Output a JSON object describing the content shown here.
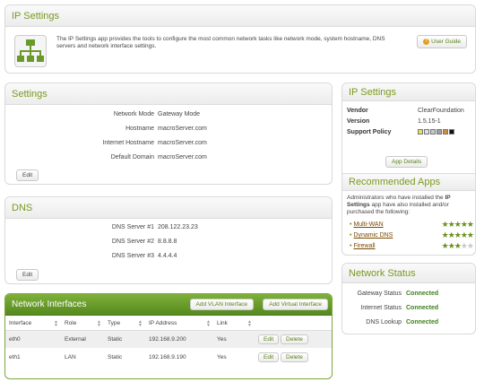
{
  "app": {
    "title": "IP Settings",
    "description": "The IP Settings app provides the tools to configure the most common network tasks like network mode, system hostname, DNS servers and network interface settings.",
    "user_guide_label": "User Guide"
  },
  "settings": {
    "title": "Settings",
    "rows": [
      {
        "label": "Network Mode",
        "value": "Gateway Mode"
      },
      {
        "label": "Hostname",
        "value": "macroServer.com"
      },
      {
        "label": "Internet Hostname",
        "value": "macroServer.com"
      },
      {
        "label": "Default Domain",
        "value": "macroServer.com"
      }
    ],
    "edit_label": "Edit"
  },
  "dns": {
    "title": "DNS",
    "rows": [
      {
        "label": "DNS Server #1",
        "value": "208.122.23.23"
      },
      {
        "label": "DNS Server #2",
        "value": "8.8.8.8"
      },
      {
        "label": "DNS Server #3",
        "value": "4.4.4.4"
      }
    ],
    "edit_label": "Edit"
  },
  "interfaces": {
    "title": "Network Interfaces",
    "add_vlan_label": "Add VLAN Interface",
    "add_virtual_label": "Add Virtual Interface",
    "columns": [
      "Interface",
      "Role",
      "Type",
      "IP Address",
      "Link"
    ],
    "rows": [
      {
        "interface": "eth0",
        "role": "External",
        "type": "Static",
        "ip": "192.168.9.200",
        "link": "Yes",
        "edit": "Edit",
        "delete": "Delete"
      },
      {
        "interface": "eth1",
        "role": "LAN",
        "type": "Static",
        "ip": "192.168.9.190",
        "link": "Yes",
        "edit": "Edit",
        "delete": "Delete"
      }
    ]
  },
  "sidebar": {
    "info_title": "IP Settings",
    "vendor_label": "Vendor",
    "vendor": "ClearFoundation",
    "version_label": "Version",
    "version": "1.5.15-1",
    "support_label": "Support Policy",
    "support_colors": [
      "#e8e05a",
      "#e0e0e0",
      "#c8c8c8",
      "#a0a0a0",
      "#c89040",
      "#111111"
    ],
    "app_details_label": "App Details",
    "recommended_title": "Recommended Apps",
    "recommended_text_pre": "Administrators who have installed the ",
    "recommended_text_app": "IP Settings",
    "recommended_text_post": " app have also installed and/or purchased the following:",
    "recommended": [
      {
        "name": "Multi-WAN",
        "rating": 5
      },
      {
        "name": "Dynamic DNS",
        "rating": 5
      },
      {
        "name": "Firewall",
        "rating": 3
      }
    ],
    "status_title": "Network Status",
    "status": [
      {
        "label": "Gateway Status",
        "value": "Connected"
      },
      {
        "label": "Internet Status",
        "value": "Connected"
      },
      {
        "label": "DNS Lookup",
        "value": "Connected"
      }
    ]
  }
}
